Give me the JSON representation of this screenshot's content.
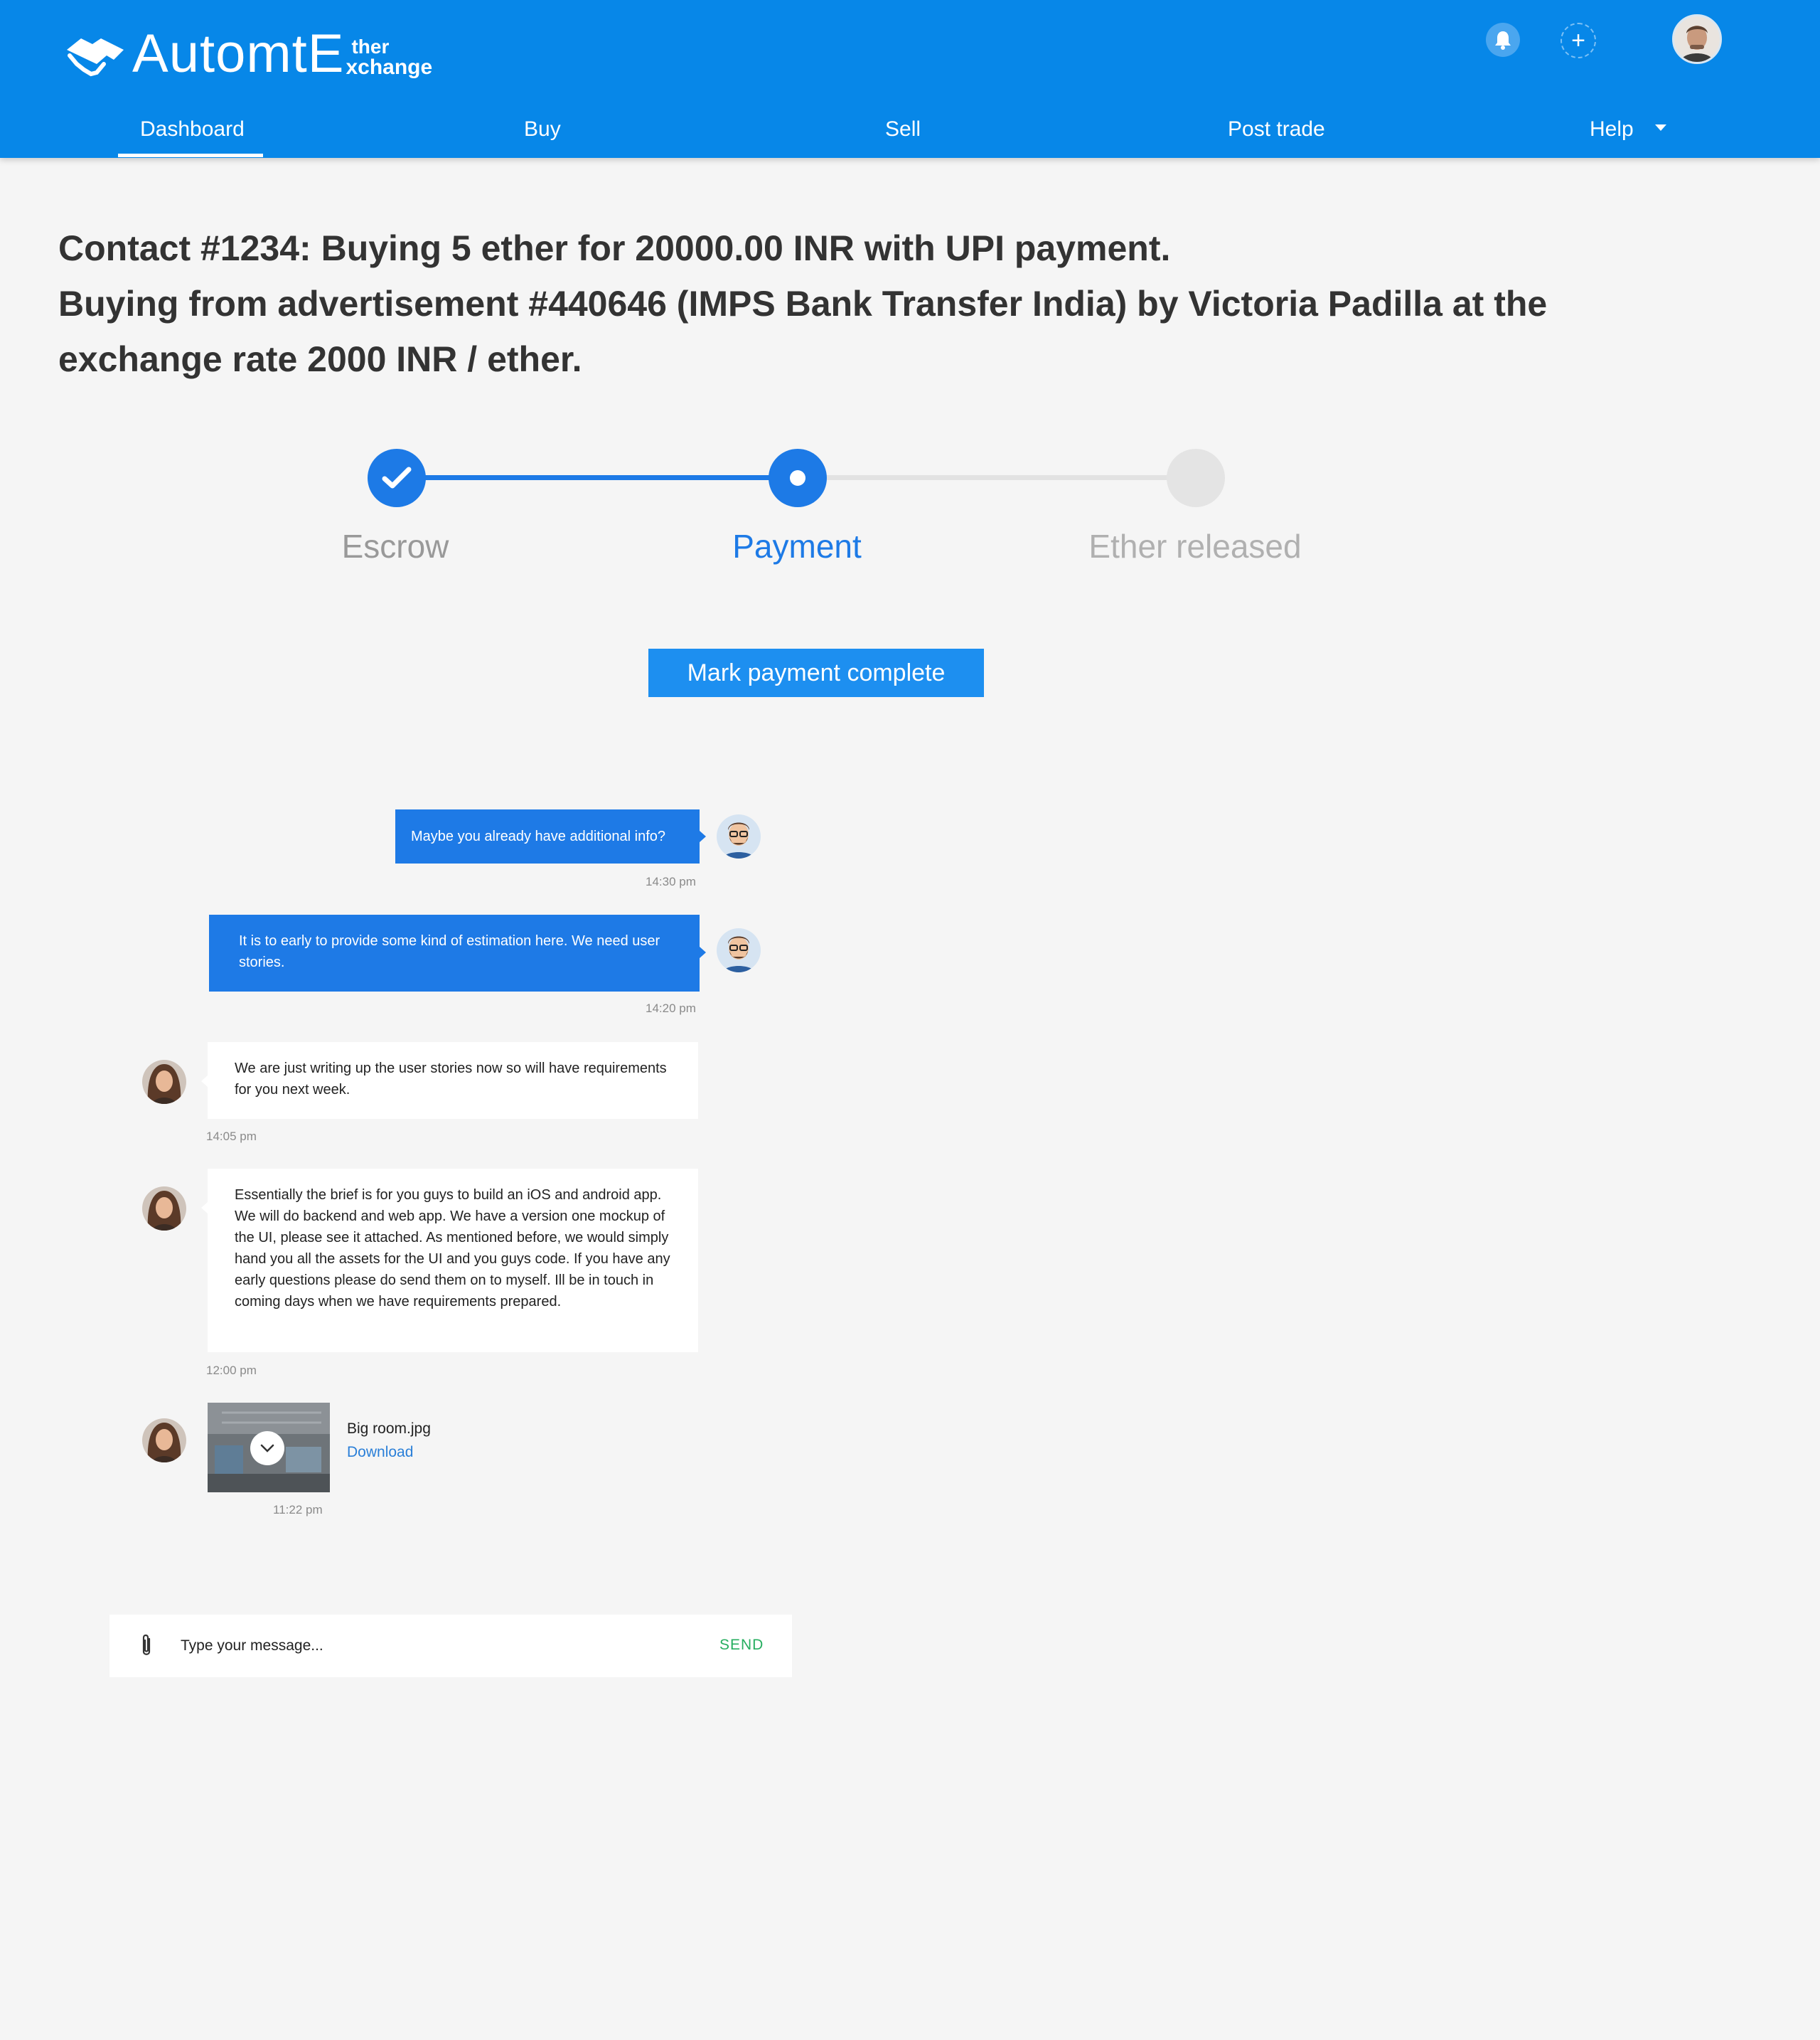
{
  "header": {
    "logo_main": "AutomtE",
    "logo_sup": "ther",
    "logo_sub": "xchange",
    "icons": [
      "bell-icon",
      "plus-icon",
      "user-avatar"
    ],
    "nav": [
      {
        "label": "Dashboard",
        "active": true
      },
      {
        "label": "Buy"
      },
      {
        "label": "Sell"
      },
      {
        "label": "Post trade"
      },
      {
        "label": "Help"
      }
    ]
  },
  "title": {
    "line1": "Contact #1234: Buying 5 ether for 20000.00 INR with UPI payment.",
    "line2": "Buying from advertisement #440646 (IMPS Bank Transfer India) by Victoria Padilla at the",
    "line3": "exchange  rate 2000 INR / ether."
  },
  "stepper": {
    "steps": [
      {
        "label": "Escrow",
        "state": "done"
      },
      {
        "label": "Payment",
        "state": "active"
      },
      {
        "label": "Ether released",
        "state": "pending"
      }
    ]
  },
  "mark_button": "Mark payment complete",
  "chat": {
    "messages": [
      {
        "dir": "out",
        "text": "Maybe you already have additional info?",
        "time": "14:30 pm"
      },
      {
        "dir": "out",
        "text": "It is to early to provide some kind of estimation here. We need user stories.",
        "time": "14:20 pm"
      },
      {
        "dir": "in",
        "text": "We are just writing up the user stories now so will have requirements for you next week.",
        "time": "14:05 pm"
      },
      {
        "dir": "in",
        "text": "Essentially the brief is for you guys to build an iOS and android app. We will do backend and web app. We have a version one mockup of the UI, please see it attached. As mentioned before, we would simply hand you all the assets for the UI and you guys code. If you have any early questions please do send them on to myself. Ill be in touch in coming days when we have requirements prepared.",
        "time": "12:00 pm"
      }
    ],
    "attachment": {
      "file_name": "Big room.jpg",
      "action": "Download",
      "time": "11:22 pm"
    }
  },
  "composer": {
    "placeholder": "Type your message...",
    "send_label": "SEND"
  },
  "colors": {
    "header_bg": "#0787e8",
    "accent": "#1d7ae6",
    "send": "#27ae60",
    "inactive_step": "#e2e2e2"
  }
}
